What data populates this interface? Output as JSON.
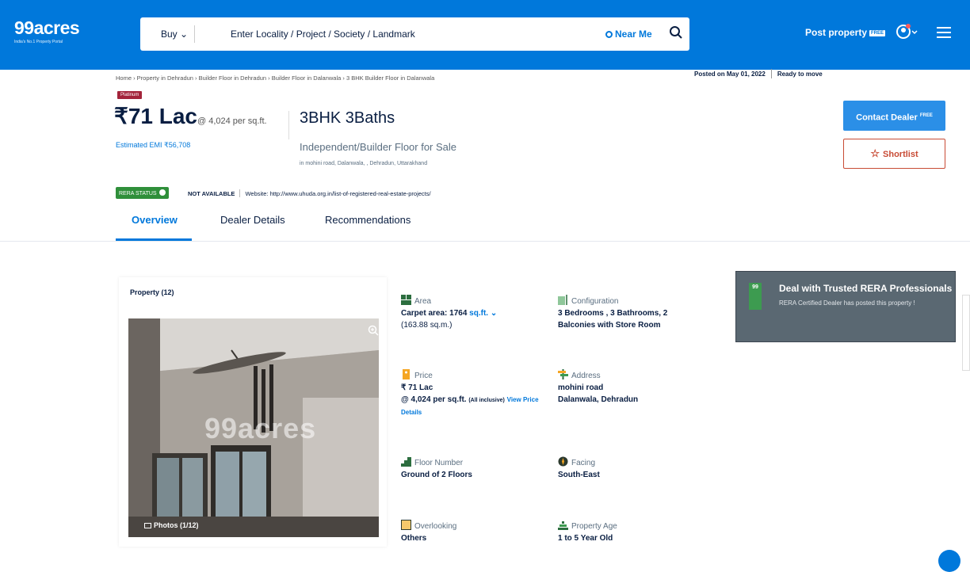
{
  "header": {
    "logo": "99acres",
    "tagline": "India's No.1 Property Portal",
    "buy_label": "Buy",
    "search_placeholder": "Enter Locality / Project / Society / Landmark",
    "near_me": "Near Me",
    "post_property": "Post property",
    "post_badge": "FREE"
  },
  "breadcrumb": "Home › Property in Dehradun › Builder Floor in Dehradun › Builder Floor in Dalanwala › 3 BHK Builder Floor in Dalanwala",
  "posted_on": "Posted on May 01, 2022",
  "ready": "Ready to move",
  "listing": {
    "badge": "Platinum",
    "price": "₹71 Lac",
    "price_per": "@ 4,024 per sq.ft.",
    "emi": "Estimated EMI ₹56,708",
    "title": "3BHK 3Baths",
    "subtitle": "Independent/Builder Floor for Sale",
    "locality": "in mohini road, Dalanwala, , Dehradun, Uttarakhand"
  },
  "actions": {
    "contact": "Contact Dealer",
    "contact_badge": "FREE",
    "shortlist": "Shortlist"
  },
  "rera": {
    "badge": "RERA STATUS",
    "status": "NOT AVAILABLE",
    "website": "Website: http://www.uhuda.org.in/list-of-registered-real-estate-projects/"
  },
  "tabs": [
    "Overview",
    "Dealer Details",
    "Recommendations"
  ],
  "property_card": {
    "title": "Property (12)",
    "photos": "Photos (1/12)",
    "watermark": "99acres"
  },
  "details": {
    "area": {
      "label": "Area",
      "value": "Carpet area: 1764",
      "unit": "sq.ft.",
      "sub": "(163.88 sq.m.)"
    },
    "configuration": {
      "label": "Configuration",
      "value": "3 Bedrooms , 3 Bathrooms, 2 Balconies with Store Room"
    },
    "price": {
      "label": "Price",
      "value": "₹ 71 Lac",
      "value2": "@ 4,024 per sq.ft.",
      "inclusive": "(All inclusive)",
      "link": "View Price Details"
    },
    "address": {
      "label": "Address",
      "value": "mohini road",
      "value2": "Dalanwala, Dehradun"
    },
    "floor": {
      "label": "Floor Number",
      "value": "Ground of 2 Floors"
    },
    "facing": {
      "label": "Facing",
      "value": "South-East"
    },
    "overlooking": {
      "label": "Overlooking",
      "value": "Others"
    },
    "age": {
      "label": "Property Age",
      "value": "1 to 5 Year Old"
    }
  },
  "promo": {
    "logo_text": "99",
    "title": "Deal with Trusted RERA Professionals",
    "text": "RERA Certified Dealer has posted this property !"
  },
  "colors": {
    "brand": "#0078db",
    "platinum": "#a3243b",
    "rera_green": "#2f8f3a",
    "shortlist": "#c84b35"
  }
}
